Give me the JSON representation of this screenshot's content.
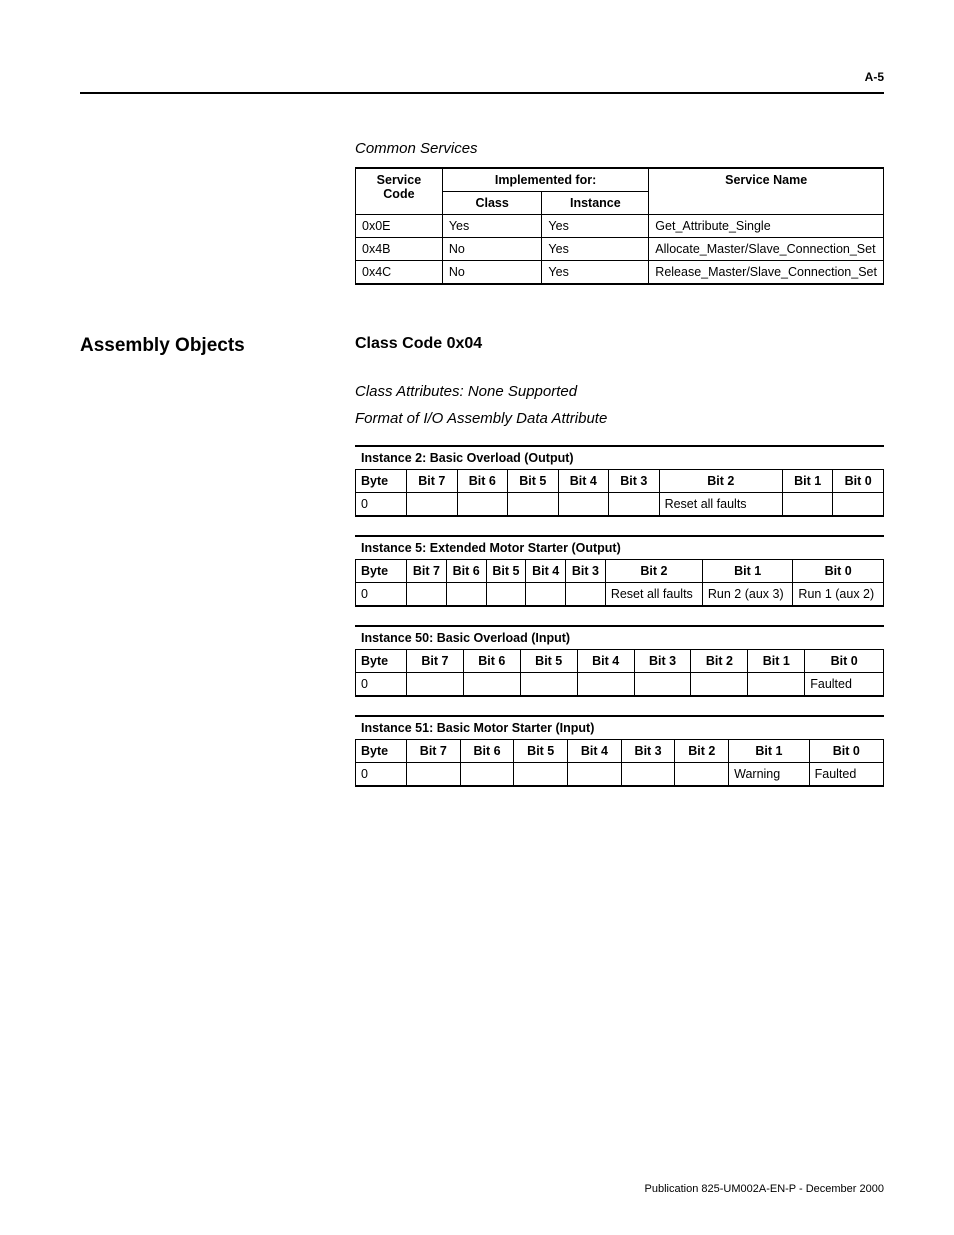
{
  "page_number": "A-5",
  "common_services": {
    "title": "Common Services",
    "headers": {
      "service_code": "Service Code",
      "implemented_for": "Implemented for:",
      "class": "Class",
      "instance": "Instance",
      "service_name": "Service Name"
    },
    "rows": [
      {
        "code": "0x0E",
        "class": "Yes",
        "instance": "Yes",
        "name": "Get_Attribute_Single"
      },
      {
        "code": "0x4B",
        "class": "No",
        "instance": "Yes",
        "name": "Allocate_Master/Slave_Connection_Set"
      },
      {
        "code": "0x4C",
        "class": "No",
        "instance": "Yes",
        "name": "Release_Master/Slave_Connection_Set"
      }
    ]
  },
  "assembly": {
    "section": "Assembly Objects",
    "class_code": "Class Code 0x04",
    "class_attr": "Class Attributes: None Supported",
    "format_head": "Format of I/O Assembly Data Attribute",
    "bit_headers": [
      "Byte",
      "Bit 7",
      "Bit 6",
      "Bit 5",
      "Bit 4",
      "Bit 3",
      "Bit 2",
      "Bit 1",
      "Bit 0"
    ],
    "tables": [
      {
        "caption": "Instance 2: Basic Overload (Output)",
        "rows": [
          {
            "byte": "0",
            "b7": "",
            "b6": "",
            "b5": "",
            "b4": "",
            "b3": "",
            "b2": "Reset all faults",
            "b1": "",
            "b0": ""
          }
        ]
      },
      {
        "caption": "Instance 5: Extended Motor Starter (Output)",
        "rows": [
          {
            "byte": "0",
            "b7": "",
            "b6": "",
            "b5": "",
            "b4": "",
            "b3": "",
            "b2": "Reset all faults",
            "b1": "Run 2 (aux 3)",
            "b0": "Run 1 (aux 2)"
          }
        ]
      },
      {
        "caption": "Instance 50: Basic Overload (Input)",
        "rows": [
          {
            "byte": "0",
            "b7": "",
            "b6": "",
            "b5": "",
            "b4": "",
            "b3": "",
            "b2": "",
            "b1": "",
            "b0": "Faulted"
          }
        ]
      },
      {
        "caption": "Instance 51: Basic Motor Starter (Input)",
        "rows": [
          {
            "byte": "0",
            "b7": "",
            "b6": "",
            "b5": "",
            "b4": "",
            "b3": "",
            "b2": "",
            "b1": "Warning",
            "b0": "Faulted"
          }
        ]
      }
    ]
  },
  "footer": "Publication 825-UM002A-EN-P - December 2000"
}
